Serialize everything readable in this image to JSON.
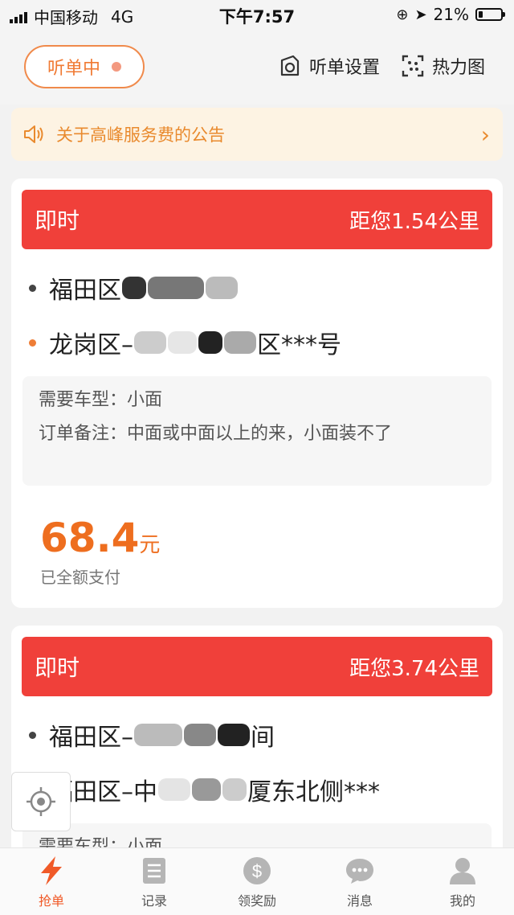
{
  "status_bar": {
    "carrier": "中国移动",
    "network": "4G",
    "time": "下午7:57",
    "battery": "21%",
    "battery_level": 0.21
  },
  "header": {
    "listen_label": "听单中",
    "settings_label": "听单设置",
    "heatmap_label": "热力图"
  },
  "notice": {
    "text": "关于高峰服务费的公告"
  },
  "orders": [
    {
      "type": "即时",
      "distance": "距您1.54公里",
      "from": "福田区",
      "to_prefix": "龙岗区–",
      "to_suffix": "区***号",
      "vehicle_label": "需要车型：",
      "vehicle": "小面",
      "note_label": "订单备注：",
      "note": "中面或中面以上的来，小面装不了",
      "price": "68.4",
      "price_unit": "元",
      "payment_status": "已全额支付"
    },
    {
      "type": "即时",
      "distance": "距您3.74公里",
      "from_prefix": "福田区–",
      "from_suffix": "间",
      "to_prefix": "福田区–中",
      "to_suffix": "厦东北侧***",
      "vehicle_label": "需要车型：",
      "vehicle": "小面"
    }
  ],
  "tabs": [
    {
      "label": "抢单",
      "icon": "bolt-icon",
      "active": true
    },
    {
      "label": "记录",
      "icon": "list-icon",
      "active": false
    },
    {
      "label": "领奖励",
      "icon": "dollar-icon",
      "active": false
    },
    {
      "label": "消息",
      "icon": "chat-icon",
      "active": false
    },
    {
      "label": "我的",
      "icon": "person-icon",
      "active": false
    }
  ],
  "colors": {
    "accent": "#f0403a",
    "orange": "#ee6e1f",
    "notice_bg": "#fdf3e3"
  }
}
